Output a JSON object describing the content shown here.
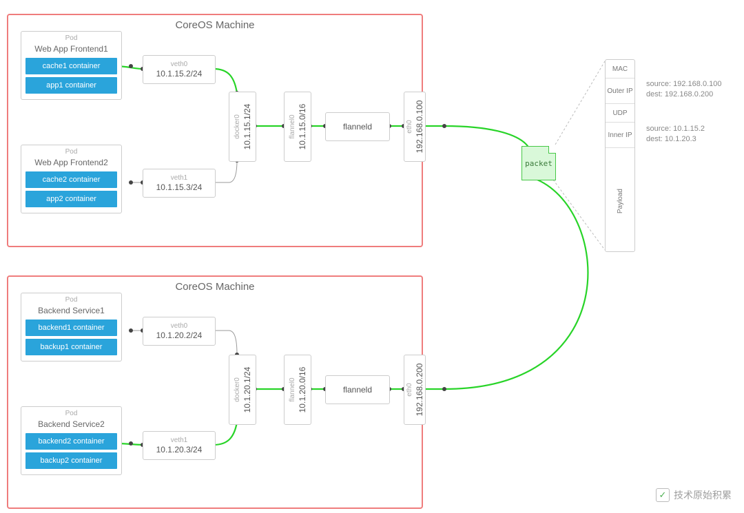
{
  "machine_title": "CoreOS Machine",
  "m1": {
    "pod1": {
      "label": "Pod",
      "name": "Web App Frontend1",
      "cont1": "cache1 container",
      "cont2": "app1 container"
    },
    "pod2": {
      "label": "Pod",
      "name": "Web App Frontend2",
      "cont1": "cache2 container",
      "cont2": "app2 container"
    },
    "veth0": {
      "label": "veth0",
      "ip": "10.1.15.2/24"
    },
    "veth1": {
      "label": "veth1",
      "ip": "10.1.15.3/24"
    },
    "docker0": {
      "label": "docker0",
      "ip": "10.1.15.1/24"
    },
    "flannel": {
      "label": "flannel0",
      "ip": "10.1.15.0/16"
    },
    "flanneld": "flanneld",
    "eth0": {
      "label": "eth0",
      "ip": "192.168.0.100"
    }
  },
  "m2": {
    "pod1": {
      "label": "Pod",
      "name": "Backend Service1",
      "cont1": "backend1 container",
      "cont2": "backup1 container"
    },
    "pod2": {
      "label": "Pod",
      "name": "Backend Service2",
      "cont1": "backend2 container",
      "cont2": "backup2 container"
    },
    "veth0": {
      "label": "veth0",
      "ip": "10.1.20.2/24"
    },
    "veth1": {
      "label": "veth1",
      "ip": "10.1.20.3/24"
    },
    "docker0": {
      "label": "docker0",
      "ip": "10.1.20.1/24"
    },
    "flannel": {
      "label": "flannel0",
      "ip": "10.1.20.0/16"
    },
    "flanneld": "flanneld",
    "eth0": {
      "label": "eth0",
      "ip": "192.168.0.200"
    }
  },
  "packet_label": "packet",
  "stack": {
    "mac": "MAC",
    "oip": "Outer IP",
    "udp": "UDP",
    "iip": "Inner IP",
    "pay": "Payload"
  },
  "outer": {
    "src": "source: 192.168.0.100",
    "dst": "dest: 192.168.0.200"
  },
  "inner": {
    "src": "source: 10.1.15.2",
    "dst": "dest: 10.1.20.3"
  },
  "watermark": "技术原始积累"
}
